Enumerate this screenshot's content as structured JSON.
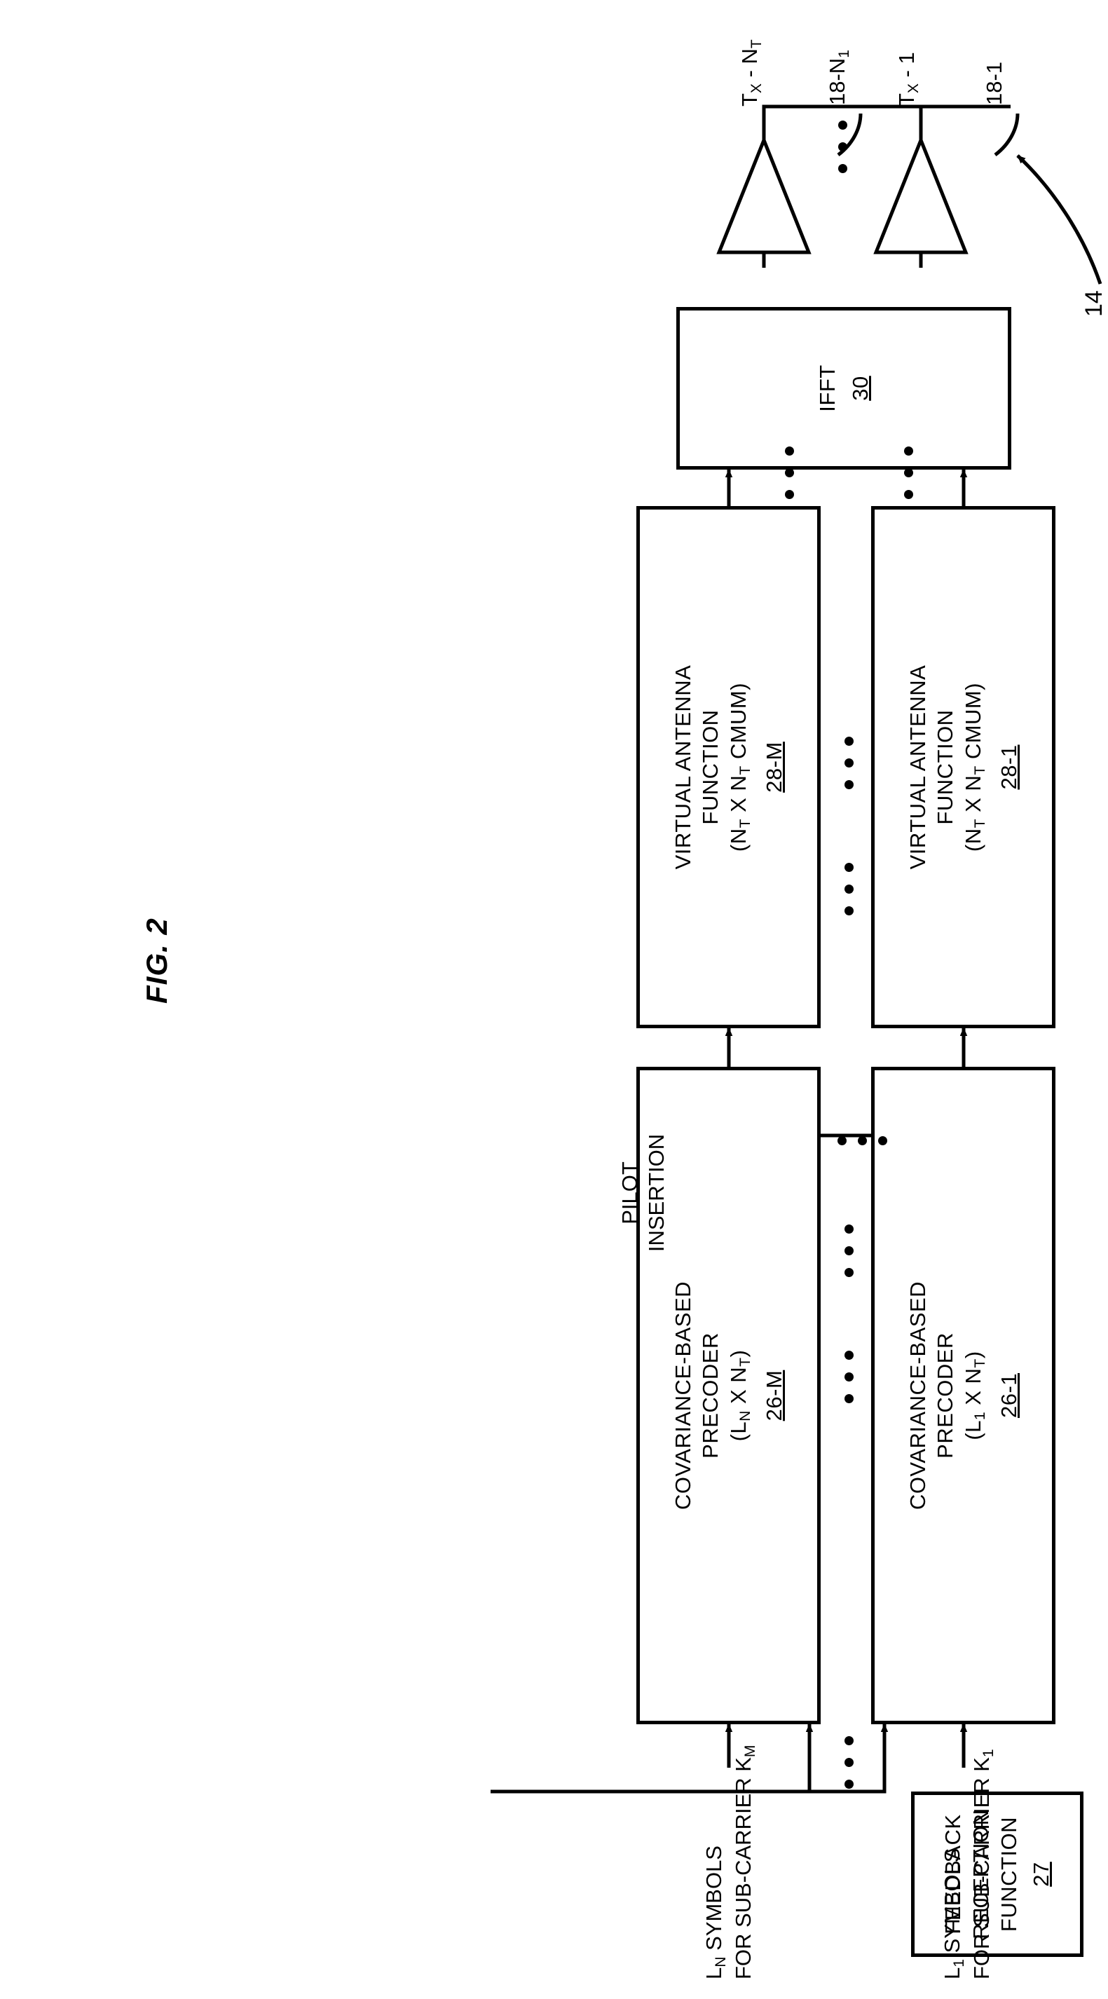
{
  "figure": {
    "title": "FIG. 2",
    "system_ref": "14"
  },
  "antennas": [
    {
      "lead_ref": "18-1",
      "label_prefix": "T",
      "label_sub": "X",
      "label_sep": " - ",
      "label_tail": "1",
      "full": "TX - 1"
    },
    {
      "lead_ref": "18-N1",
      "label_prefix": "T",
      "label_sub": "X",
      "label_sep": " - ",
      "label_tail": "NT",
      "full": "TX - NT"
    }
  ],
  "blocks": {
    "ifft": {
      "name": "IFFT",
      "ref": "30"
    },
    "virtual_antenna": [
      {
        "line1": "VIRTUAL ANTENNA",
        "line2": "FUNCTION",
        "line3": "(NT X NT CMUM)",
        "ref": "28-1"
      },
      {
        "line1": "VIRTUAL ANTENNA",
        "line2": "FUNCTION",
        "line3": "(NT X NT CMUM)",
        "ref": "28-M"
      }
    ],
    "precoders": [
      {
        "line1": "COVARIANCE-BASED",
        "line2": "PRECODER",
        "line3": "(L1 X NT)",
        "ref": "26-1"
      },
      {
        "line1": "COVARIANCE-BASED",
        "line2": "PRECODER",
        "line3": "(LN X NT)",
        "ref": "26-M"
      }
    ],
    "feedback": {
      "line1": "FEEDBACK",
      "line2": "RECEPTION",
      "line3": "FUNCTION",
      "ref": "27"
    }
  },
  "io_labels": {
    "input_top_line1": "L1 SYMBOLS",
    "input_top_line2": "FOR SUB-CARRIER K1",
    "input_bottom_line1": "LN SYMBOLS",
    "input_bottom_line2": "FOR SUB-CARRIER KM",
    "pilot_line1": "PILOT",
    "pilot_line2": "INSERTION"
  },
  "ellipsis_marker": "• • •",
  "colors": {
    "stroke": "#000000",
    "background": "#ffffff"
  }
}
